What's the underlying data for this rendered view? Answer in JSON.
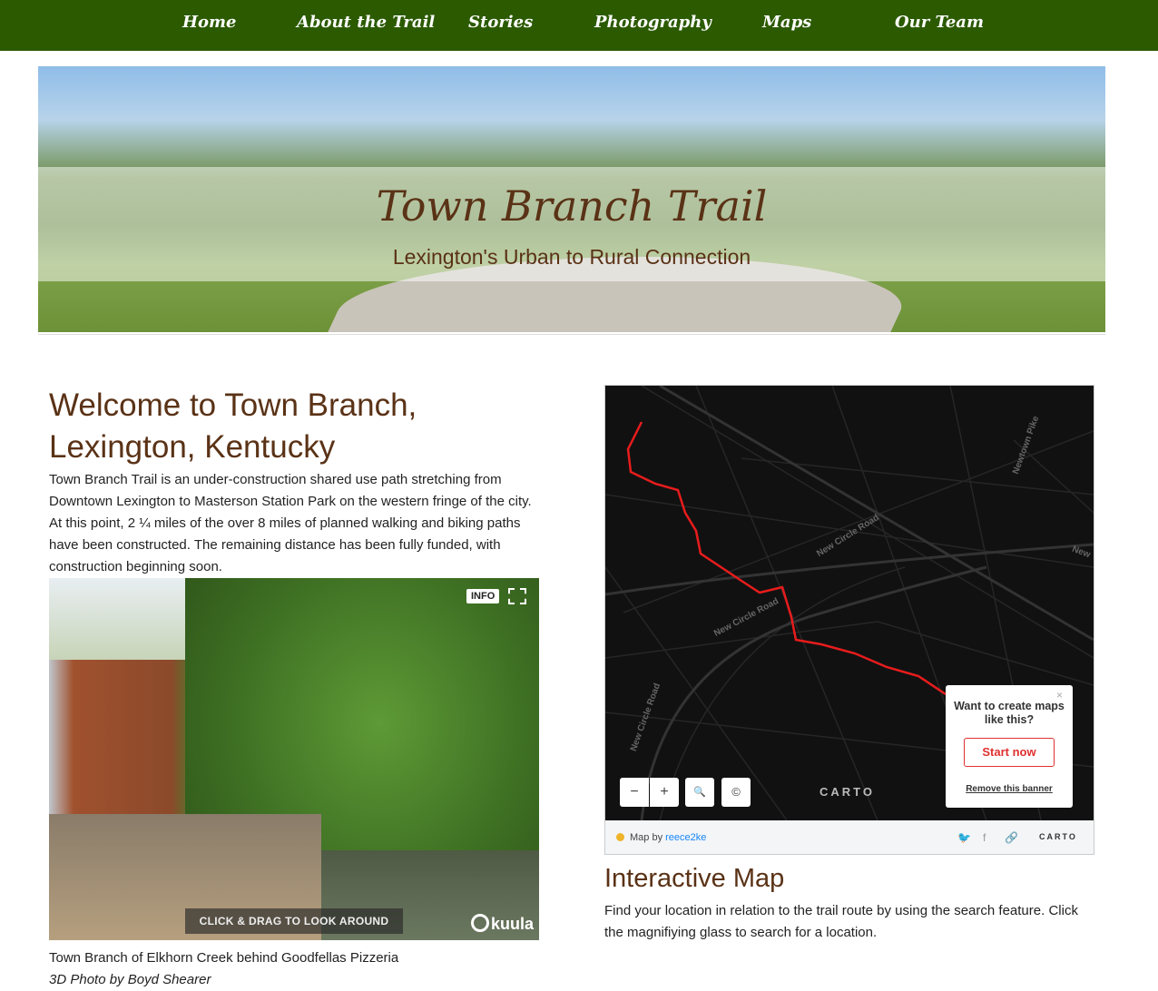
{
  "nav": {
    "items": [
      "Home",
      "About the Trail",
      "Stories",
      "Photography",
      "Maps",
      "Our Team"
    ]
  },
  "hero": {
    "title": "Town Branch Trail",
    "subtitle": "Lexington's Urban to Rural Connection"
  },
  "welcome": {
    "heading_line1": "Welcome to Town Branch,",
    "heading_line2": "Lexington, Kentucky",
    "paragraph": "Town Branch Trail is an under-construction shared use path stretching from Downtown Lexington to Masterson Station Park on the western fringe of the city. At this point, 2 ¼ miles of the over 8 miles of planned walking and biking paths have been constructed. The remaining distance has been fully funded, with construction beginning soon."
  },
  "photo": {
    "info_label": "INFO",
    "drag_label": "CLICK & DRAG TO LOOK AROUND",
    "brand": "kuula",
    "caption": "Town Branch of Elkhorn Creek behind Goodfellas Pizzeria",
    "credit": "3D Photo by Boyd Shearer"
  },
  "map": {
    "road_labels": [
      "New Circle Road",
      "New Circle Road",
      "New Circle Road",
      "Newtown Pike",
      "New"
    ],
    "zoom_out": "−",
    "zoom_in": "+",
    "search": "🔍",
    "attribution": "©",
    "carto_logo": "CARTO",
    "popup": {
      "question": "Want to create maps like this?",
      "cta": "Start now",
      "remove": "Remove this banner",
      "close": "×"
    },
    "footer": {
      "map_by": "Map by",
      "author": "reece2ke",
      "carto": "CARTO"
    }
  },
  "interactive": {
    "heading": "Interactive Map",
    "paragraph": "Find your location in relation to the trail route by using the search feature. Click the magnifiying glass to search for a location."
  }
}
